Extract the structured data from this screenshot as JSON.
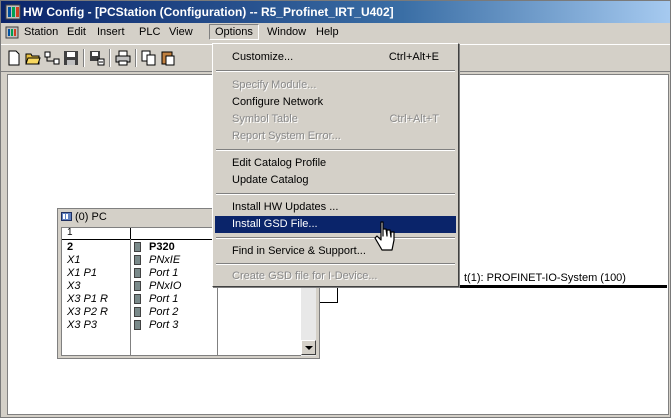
{
  "window": {
    "title": "HW Config - [PCStation (Configuration) -- R5_Profinet_IRT_U402]"
  },
  "menubar": {
    "items": [
      "Station",
      "Edit",
      "Insert",
      "PLC",
      "View",
      "Options",
      "Window",
      "Help"
    ],
    "open_item": "Options"
  },
  "toolbar": {
    "icons": [
      "new-icon",
      "open-icon",
      "network-icon",
      "save-icon",
      "save-compile-icon",
      "print-icon",
      "copy-icon",
      "paste-icon"
    ]
  },
  "options_menu": {
    "items": [
      {
        "label": "Customize...",
        "shortcut": "Ctrl+Alt+E",
        "enabled": true
      },
      {
        "label": "Specify Module...",
        "shortcut": "",
        "enabled": false
      },
      {
        "label": "Configure Network",
        "shortcut": "",
        "enabled": true
      },
      {
        "label": "Symbol Table",
        "shortcut": "Ctrl+Alt+T",
        "enabled": false
      },
      {
        "label": "Report System Error...",
        "shortcut": "",
        "enabled": false
      },
      {
        "label": "Edit Catalog Profile",
        "shortcut": "",
        "enabled": true
      },
      {
        "label": "Update Catalog",
        "shortcut": "",
        "enabled": true
      },
      {
        "label": "Install HW Updates ...",
        "shortcut": "",
        "enabled": true
      },
      {
        "label": "Install GSD File...",
        "shortcut": "",
        "enabled": true,
        "selected": true
      },
      {
        "label": "Find in Service & Support...",
        "shortcut": "",
        "enabled": true
      },
      {
        "label": "Create GSD file for I-Device...",
        "shortcut": "",
        "enabled": false
      }
    ]
  },
  "station_window": {
    "title": "(0) PC",
    "header": "1",
    "rows": [
      {
        "slot": "2",
        "module": "P320",
        "bold": true
      },
      {
        "slot": "X1",
        "module": "PNxIE"
      },
      {
        "slot": "X1 P1",
        "module": "Port 1"
      },
      {
        "slot": "X3",
        "module": "PNxIO"
      },
      {
        "slot": "X3 P1 R",
        "module": "Port 1"
      },
      {
        "slot": "X3 P2 R",
        "module": "Port 2"
      },
      {
        "slot": "X3 P3",
        "module": "Port 3"
      }
    ]
  },
  "network": {
    "label": "t(1): PROFINET-IO-System (100)"
  }
}
